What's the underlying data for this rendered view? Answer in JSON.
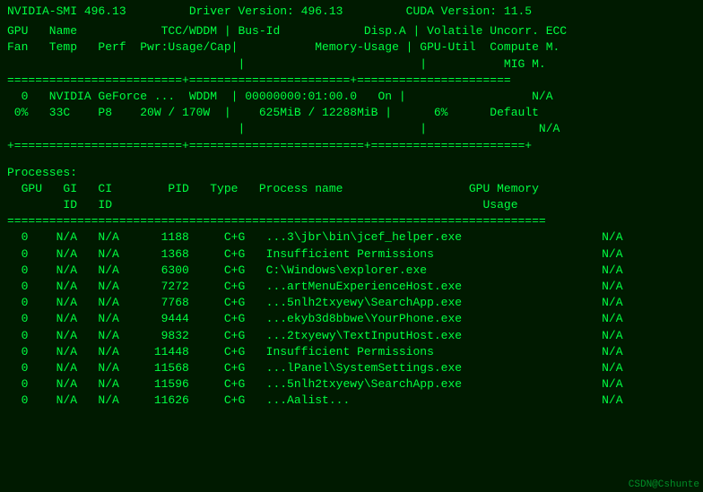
{
  "terminal": {
    "header": "NVIDIA-SMI 496.13         Driver Version: 496.13         CUDA Version: 11.5",
    "column_headers_1": "GPU   Name            TCC/WDDM | Bus-Id            Disp.A | Volatile Uncorr. ECC",
    "column_headers_2": "Fan   Temp   Perf  Pwr:Usage/Cap|           Memory-Usage | GPU-Util  Compute M.",
    "column_headers_3": "                                 |                         |           MIG M.",
    "divider_top": "=========================+=======================+======================",
    "gpu_row1": "  0   NVIDIA GeForce ...  WDDM  | 00000000:01:00.0   On |                  N/A",
    "gpu_row2": " 0%   33C    P8    20W / 170W  |    625MiB / 12288MiB |      6%      Default",
    "gpu_row3": "                                 |                         |                N/A",
    "divider_bottom": "+========================+=========================+======================+",
    "spacer": "",
    "processes_label": "Processes:",
    "proc_col_header1": "  GPU   GI   CI        PID   Type   Process name                  GPU Memory",
    "proc_col_header2": "        ID   ID                                                     Usage",
    "proc_divider": "=============================================================================",
    "processes": [
      {
        "gpu": "0",
        "gi": "N/A",
        "ci": "N/A",
        "pid": "1188",
        "type": "C+G",
        "name": "...3\\jbr\\bin\\jcef_helper.exe",
        "mem": "N/A"
      },
      {
        "gpu": "0",
        "gi": "N/A",
        "ci": "N/A",
        "pid": "1368",
        "type": "C+G",
        "name": "Insufficient Permissions",
        "mem": "N/A"
      },
      {
        "gpu": "0",
        "gi": "N/A",
        "ci": "N/A",
        "pid": "6300",
        "type": "C+G",
        "name": "C:\\Windows\\explorer.exe",
        "mem": "N/A"
      },
      {
        "gpu": "0",
        "gi": "N/A",
        "ci": "N/A",
        "pid": "7272",
        "type": "C+G",
        "name": "...artMenuExperienceHost.exe",
        "mem": "N/A"
      },
      {
        "gpu": "0",
        "gi": "N/A",
        "ci": "N/A",
        "pid": "7768",
        "type": "C+G",
        "name": "...5nlh2txyewy\\SearchApp.exe",
        "mem": "N/A"
      },
      {
        "gpu": "0",
        "gi": "N/A",
        "ci": "N/A",
        "pid": "9444",
        "type": "C+G",
        "name": "...ekyb3d8bbwe\\YourPhone.exe",
        "mem": "N/A"
      },
      {
        "gpu": "0",
        "gi": "N/A",
        "ci": "N/A",
        "pid": "9832",
        "type": "C+G",
        "name": "...2txyewy\\TextInputHost.exe",
        "mem": "N/A"
      },
      {
        "gpu": "0",
        "gi": "N/A",
        "ci": "N/A",
        "pid": "11448",
        "type": "C+G",
        "name": "Insufficient Permissions",
        "mem": "N/A"
      },
      {
        "gpu": "0",
        "gi": "N/A",
        "ci": "N/A",
        "pid": "11568",
        "type": "C+G",
        "name": "...lPanel\\SystemSettings.exe",
        "mem": "N/A"
      },
      {
        "gpu": "0",
        "gi": "N/A",
        "ci": "N/A",
        "pid": "11596",
        "type": "C+G",
        "name": "...5nlh2txyewy\\SearchApp.exe",
        "mem": "N/A"
      },
      {
        "gpu": "0",
        "gi": "N/A",
        "ci": "N/A",
        "pid": "11626",
        "type": "C+G",
        "name": "...Aalist...",
        "mem": "N/A"
      }
    ],
    "watermark": "CSDN@Cshunte"
  }
}
